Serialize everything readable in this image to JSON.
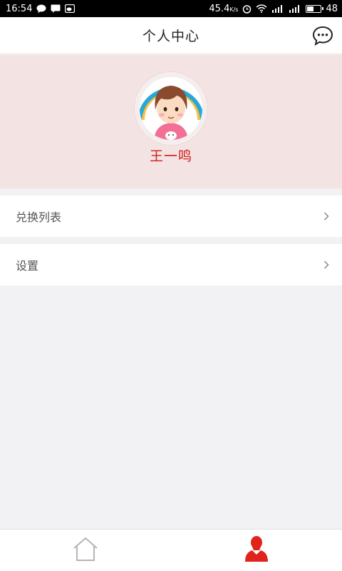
{
  "status_bar": {
    "time": "16:54",
    "network_speed": "45.4",
    "speed_unit": "K/s",
    "battery": "48",
    "icons": [
      "chat-notification-icon",
      "message-icon",
      "weibo-icon",
      "alarm-icon",
      "wifi-icon",
      "signal-4g-icon",
      "signal-icon",
      "battery-icon"
    ]
  },
  "header": {
    "title": "个人中心",
    "chat_icon": "chat-bubble-icon"
  },
  "profile": {
    "name": "王一鸣",
    "avatar": "cartoon-girl-avatar"
  },
  "menu": {
    "items": [
      {
        "label": "兑换列表",
        "icon": "chevron-right-icon"
      },
      {
        "label": "设置",
        "icon": "chevron-right-icon"
      }
    ]
  },
  "tabbar": {
    "tabs": [
      {
        "icon": "home-icon",
        "active": false
      },
      {
        "icon": "user-icon",
        "active": true
      }
    ]
  },
  "colors": {
    "accent": "#d21c1c",
    "profile_bg": "#f3e4e3",
    "page_bg": "#f2f1f4"
  }
}
